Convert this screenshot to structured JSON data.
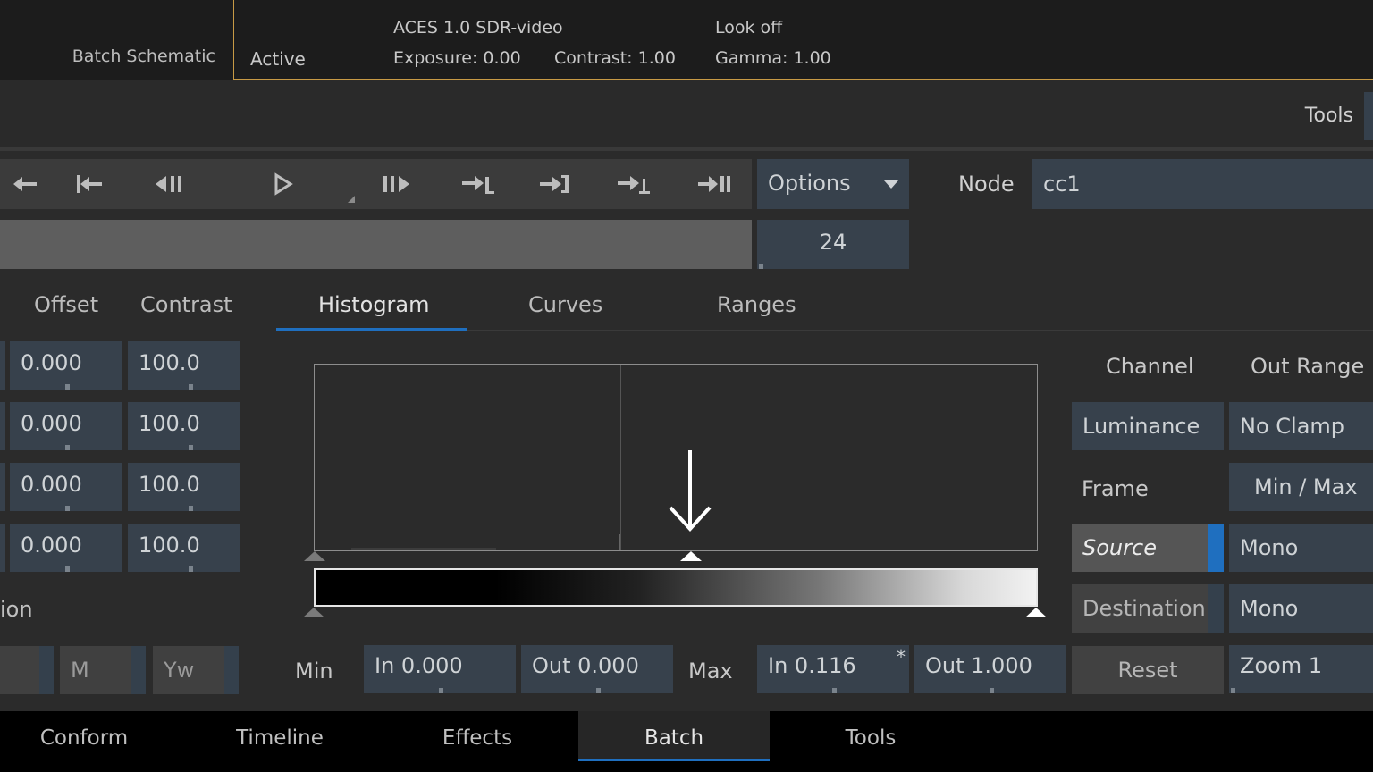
{
  "topbar": {
    "schematic": "Batch Schematic",
    "status": "Active",
    "colorspace": "ACES 1.0 SDR-video",
    "look": "Look off",
    "exposure": "Exposure: 0.00",
    "contrast": "Contrast: 1.00",
    "gamma": "Gamma: 1.00",
    "accent": "#c79a45"
  },
  "header": {
    "tools": "Tools"
  },
  "transport": {
    "options": "Options",
    "fps": "24",
    "node_label": "Node",
    "node_name": "cc1",
    "buttons": [
      "goto-start-icon",
      "step-back-icon",
      "play-back-icon",
      "play-icon",
      "play-forward-icon",
      "step-forward-icon",
      "goto-out-icon",
      "next-keyframe-icon",
      "goto-end-icon"
    ]
  },
  "columns": {
    "offset": "Offset",
    "contrast": "Contrast",
    "offset_values": [
      "0.000",
      "0.000",
      "0.000",
      "0.000"
    ],
    "contrast_values": [
      "100.0",
      "100.0",
      "100.0",
      "100.0"
    ],
    "section": "ion",
    "m": "M",
    "yw": "Yw"
  },
  "tabs": {
    "histogram": "Histogram",
    "curves": "Curves",
    "ranges": "Ranges",
    "accent": "#1f6fbf"
  },
  "levels": {
    "min": "Min",
    "max": "Max",
    "min_in": "In 0.000",
    "min_out": "Out 0.000",
    "max_in": "In 0.116",
    "max_in_mark": "*",
    "max_out": "Out 1.000"
  },
  "right": {
    "channel": "Channel",
    "out_range": "Out Range",
    "luminance": "Luminance",
    "no_clamp": "No Clamp",
    "frame": "Frame",
    "min_max": "Min / Max",
    "source": "Source",
    "mono1": "Mono",
    "destination": "Destination",
    "mono2": "Mono",
    "reset": "Reset",
    "zoom": "Zoom 1"
  },
  "bottom": {
    "conform": "Conform",
    "timeline": "Timeline",
    "effects": "Effects",
    "batch": "Batch",
    "tools": "Tools"
  }
}
